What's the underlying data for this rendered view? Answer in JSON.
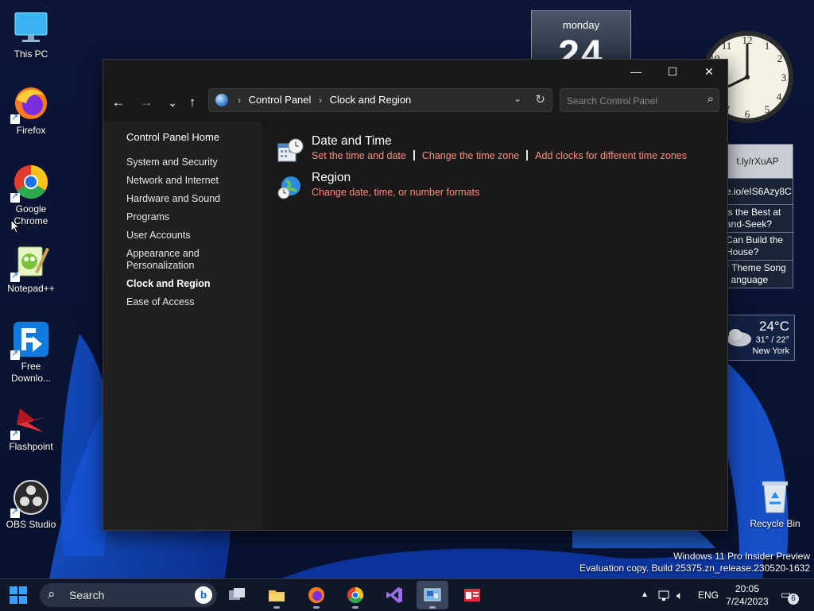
{
  "desktop": {
    "icons": [
      {
        "label": "This PC"
      },
      {
        "label": "Firefox"
      },
      {
        "label": "Google Chrome"
      },
      {
        "label": "Notepad++"
      },
      {
        "label": "Free Downlo..."
      },
      {
        "label": "Flashpoint"
      },
      {
        "label": "OBS Studio"
      },
      {
        "label": "Recycle Bin"
      }
    ],
    "watermark": {
      "line1": "Windows 11 Pro Insider Preview",
      "line2": "Evaluation copy. Build 25375.zn_release.230520-1632"
    }
  },
  "gadgets": {
    "calendar": {
      "day": "monday",
      "date": "24"
    },
    "feed": [
      "t.ly/rXuAP",
      "e.io/eIS6Azy8C",
      "ls the Best at and-Seek?",
      "Can Build the House?",
      "r Theme Song | anguage"
    ],
    "weather": {
      "temp": "24°C",
      "range": "31° / 22°",
      "city": "New York"
    }
  },
  "window": {
    "controls": {
      "minimize": "—",
      "maximize": "☐",
      "close": "✕"
    },
    "nav": {
      "back": "←",
      "forward": "→",
      "recent": "⌄",
      "up": "↑"
    },
    "address": {
      "crumbs": [
        "Control Panel",
        "Clock and Region"
      ],
      "dropdown": "⌄",
      "refresh": "↻"
    },
    "search": {
      "placeholder": "Search Control Panel"
    },
    "sidebar": {
      "home": "Control Panel Home",
      "items": [
        {
          "label": "System and Security"
        },
        {
          "label": "Network and Internet"
        },
        {
          "label": "Hardware and Sound"
        },
        {
          "label": "Programs"
        },
        {
          "label": "User Accounts"
        },
        {
          "label": "Appearance and Personalization"
        },
        {
          "label": "Clock and Region",
          "active": true
        },
        {
          "label": "Ease of Access"
        }
      ]
    },
    "categories": [
      {
        "title": "Date and Time",
        "links": [
          "Set the time and date",
          "Change the time zone",
          "Add clocks for different time zones"
        ]
      },
      {
        "title": "Region",
        "links": [
          "Change date, time, or number formats"
        ]
      }
    ]
  },
  "taskbar": {
    "search_label": "Search",
    "apps": [
      "file-explorer",
      "firefox",
      "chrome",
      "visual-studio",
      "control-panel",
      "news"
    ],
    "tray": {
      "language": "ENG",
      "time": "20:05",
      "date": "7/24/2023",
      "notifications": "6"
    }
  },
  "colors": {
    "link": "#ff8d7d",
    "window_bg": "#191919",
    "sidebar_bg": "#202020"
  }
}
